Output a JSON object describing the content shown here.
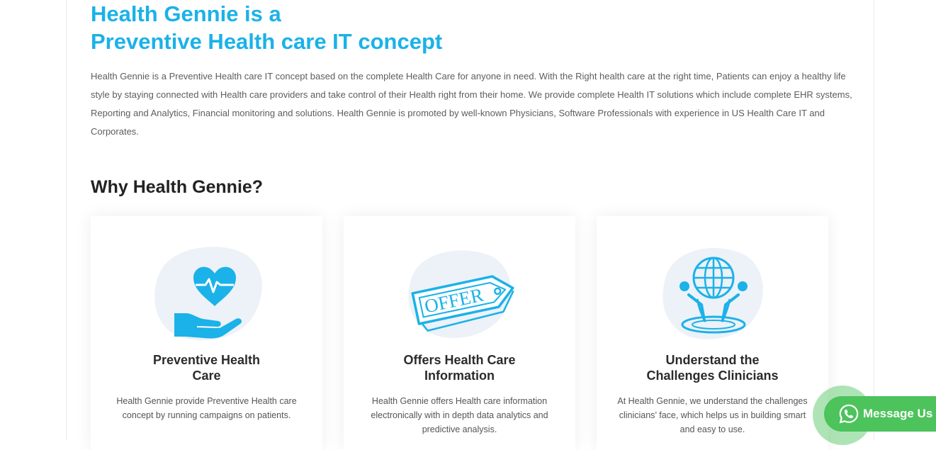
{
  "hero": {
    "title_line1": "Health Gennie is a",
    "title_line2": "Preventive Health care IT concept",
    "intro": "Health Gennie is a Preventive Health care IT concept based on the complete Health Care for anyone in need. With the Right health care at the right time, Patients can enjoy a healthy life style by staying connected with Health care providers and take control of their Health right from their home. We provide complete Health IT solutions which include complete EHR systems, Reporting and Analytics, Financial monitoring and solutions. Health Gennie is promoted by well-known Physicians, Software Professionals with experience in US Health Care IT and Corporates."
  },
  "why": {
    "heading": "Why Health Gennie?",
    "cards": [
      {
        "icon": "heart-in-hand-icon",
        "title_line1": "Preventive Health",
        "title_line2": "Care",
        "text": "Health Gennie provide Preventive Health care concept by running campaigns on patients."
      },
      {
        "icon": "offer-tag-icon",
        "title_line1": "Offers Health Care",
        "title_line2": "Information",
        "tag_text": "OFFER",
        "text": "Health Gennie offers Health care information electronically with in depth data analytics and predictive analysis."
      },
      {
        "icon": "globe-in-hands-icon",
        "title_line1": "Understand the",
        "title_line2": "Challenges Clinicians",
        "text": "At Health Gennie, we understand the challenges clinicians’ face, which helps us in building smart and easy to use."
      }
    ]
  },
  "whatsapp": {
    "label": "Message Us",
    "icon": "whatsapp-icon"
  },
  "colors": {
    "accent": "#1ab2e8",
    "icon_blob": "#edf1f8",
    "whatsapp_green": "#4cc35b"
  }
}
